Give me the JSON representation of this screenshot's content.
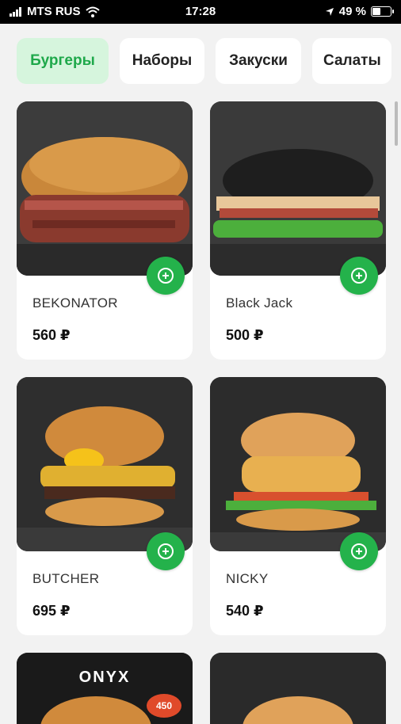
{
  "status_bar": {
    "carrier": "MTS RUS",
    "time": "17:28",
    "battery": "49 %",
    "battery_level": 0.49
  },
  "tabs": [
    {
      "label": "Бургеры",
      "active": true
    },
    {
      "label": "Наборы",
      "active": false
    },
    {
      "label": "Закуски",
      "active": false
    },
    {
      "label": "Салаты",
      "active": false
    }
  ],
  "products": [
    {
      "name": "BEKONATOR",
      "price": "560 ₽"
    },
    {
      "name": "Black Jack",
      "price": "500 ₽"
    },
    {
      "name": "BUTCHER",
      "price": "695 ₽"
    },
    {
      "name": "NICKY",
      "price": "540 ₽"
    }
  ],
  "partial_cards": [
    {
      "image_text": "ONYX",
      "badge": "450"
    },
    {
      "image_text": ""
    }
  ],
  "colors": {
    "accent": "#24b24b",
    "active_tab_bg": "#d6f5dd",
    "active_tab_text": "#1ea84a"
  }
}
